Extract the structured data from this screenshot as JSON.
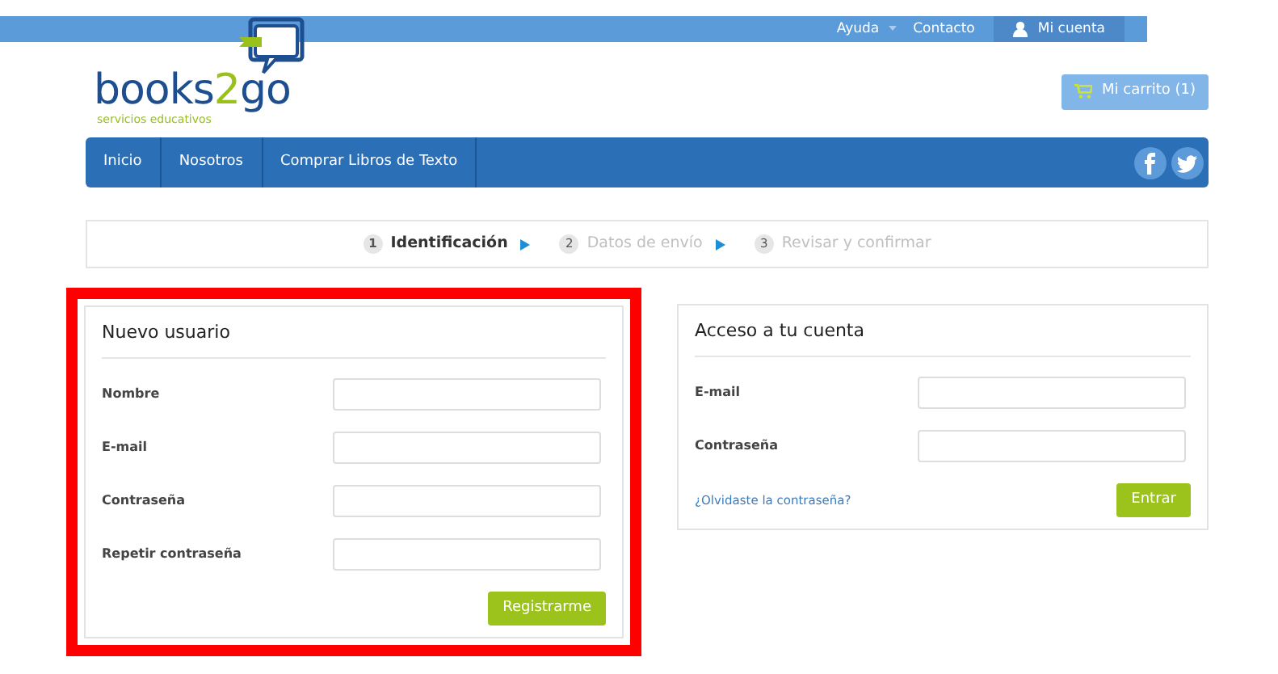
{
  "top_bar": {
    "links": [
      {
        "label": "Ayuda",
        "has_caret": true
      },
      {
        "label": "Contacto",
        "has_caret": false
      }
    ],
    "account": {
      "label": "Mi cuenta"
    }
  },
  "logo": {
    "parts": [
      {
        "text": "books",
        "accent": false
      },
      {
        "text": "2",
        "accent": true
      },
      {
        "text": "go",
        "accent": false
      }
    ],
    "tagline": "servicios educativos"
  },
  "cart_button": {
    "label": "Mi carrito (1)"
  },
  "nav": {
    "items": [
      {
        "label": "Inicio"
      },
      {
        "label": "Nosotros"
      },
      {
        "label": "Comprar Libros de Texto"
      }
    ],
    "social": [
      {
        "kind": "facebook"
      },
      {
        "kind": "twitter"
      }
    ]
  },
  "steps": [
    {
      "number": "1",
      "label": "Identificación",
      "active": true
    },
    {
      "number": "2",
      "label": "Datos de envío",
      "active": false
    },
    {
      "number": "3",
      "label": "Revisar y confirmar",
      "active": false
    }
  ],
  "panels": [
    {
      "title": "Nuevo usuario",
      "highlighted": true,
      "fields": [
        {
          "label": "Nombre"
        },
        {
          "label": "E-mail"
        },
        {
          "label": "Contraseña"
        },
        {
          "label": "Repetir contraseña"
        }
      ],
      "button": "Registrarme"
    },
    {
      "title": "Acceso a tu cuenta",
      "highlighted": false,
      "fields": [
        {
          "label": "E-mail"
        },
        {
          "label": "Contraseña"
        }
      ],
      "link": "¿Olvidaste la contraseña?",
      "button": "Entrar"
    }
  ]
}
